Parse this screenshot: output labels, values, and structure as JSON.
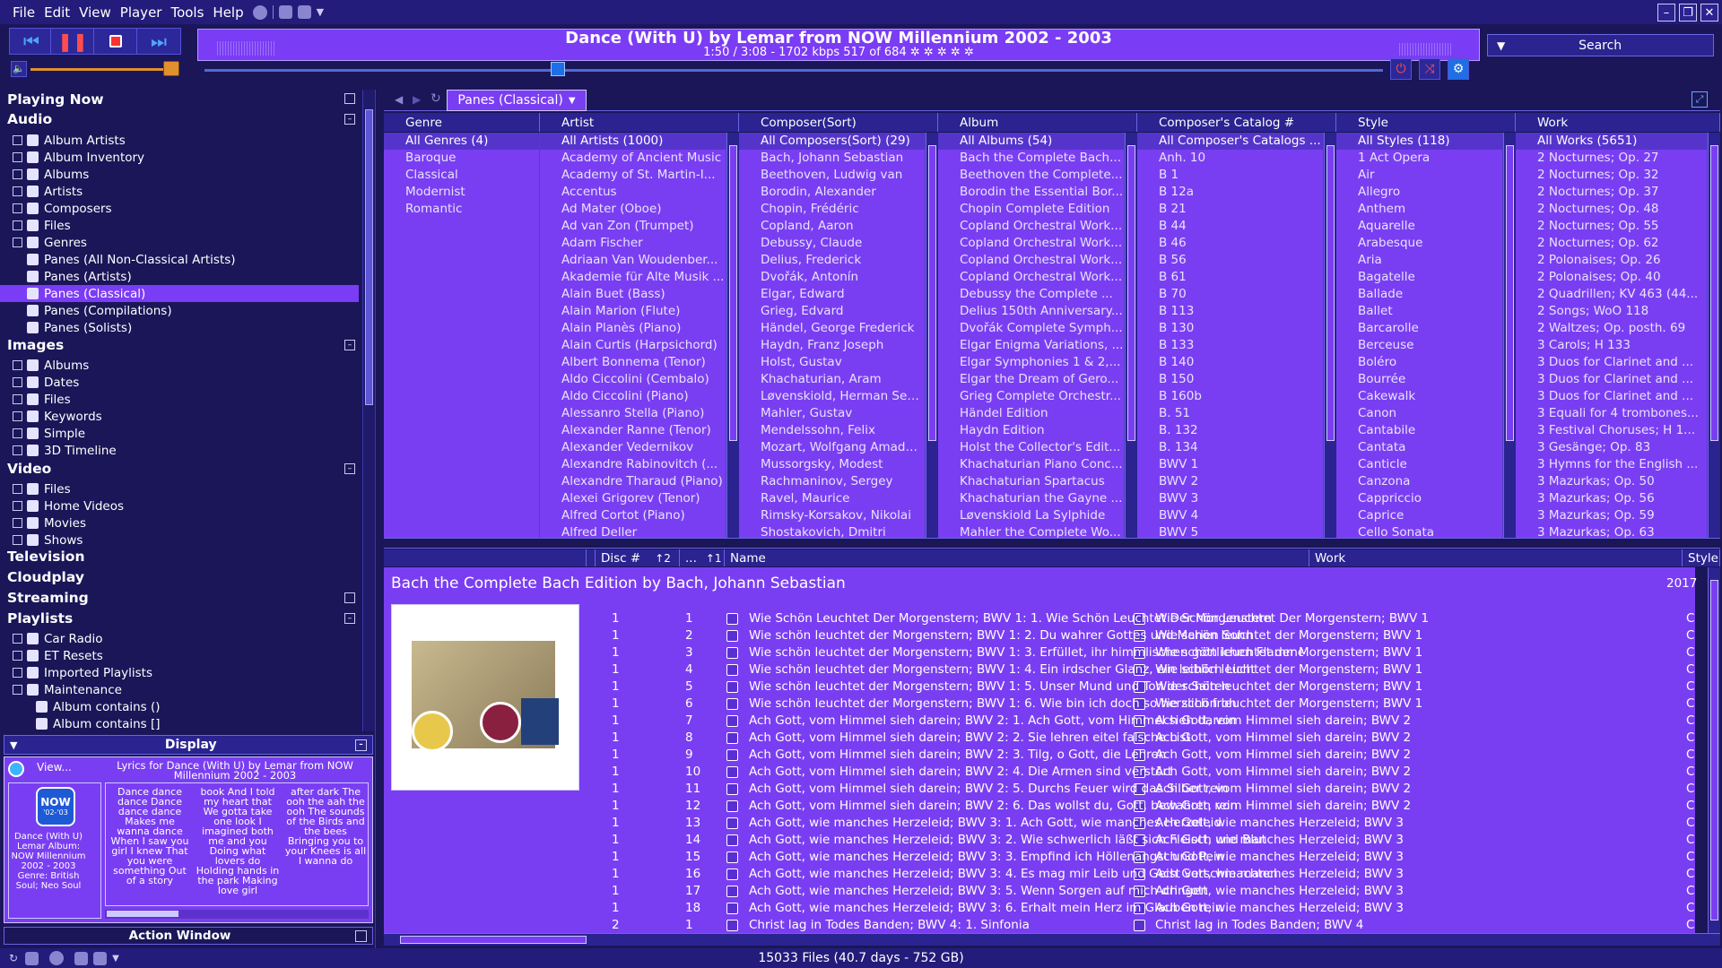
{
  "menu": [
    "File",
    "Edit",
    "View",
    "Player",
    "Tools",
    "Help"
  ],
  "now_playing": {
    "title": "Dance (With U) by Lemar from NOW Millennium 2002 - 2003",
    "info": "1:50 / 3:08 - 1702 kbps   517 of 684  ✲ ✲ ✲ ✲ ✲",
    "progress": 0.3
  },
  "volume": 0.98,
  "search": {
    "label": "Search"
  },
  "left": {
    "playing_now": "Playing Now",
    "audio_header": "Audio",
    "audio_items": [
      "Album Artists",
      "Album Inventory",
      "Albums",
      "Artists",
      "Composers",
      "Files",
      "Genres"
    ],
    "genre_children": [
      "Panes (All Non-Classical Artists)",
      "Panes (Artists)",
      "Panes (Classical)",
      "Panes (Compilations)",
      "Panes (Solists)"
    ],
    "images_header": "Images",
    "images_items": [
      "Albums",
      "Dates",
      "Files",
      "Keywords",
      "Simple",
      "3D Timeline"
    ],
    "video_header": "Video",
    "video_items": [
      "Files",
      "Home Videos",
      "Movies",
      "Shows"
    ],
    "television": "Television",
    "cloudplay": "Cloudplay",
    "streaming": "Streaming",
    "playlists_header": "Playlists",
    "playlists_items": [
      "Car Radio",
      "ET Resets",
      "Imported Playlists",
      "Maintenance"
    ],
    "maintenance_children": [
      "Album contains ()",
      "Album contains []"
    ]
  },
  "display_panel": {
    "header": "Display",
    "view_label": "View...",
    "lyrics_title": "Lyrics for Dance (With U) by Lemar from NOW Millennium 2002 - 2003",
    "album_badge": "NOW",
    "album_badge_sub": "'02-'03",
    "info_text": "Dance (With U) Lemar Album: NOW Millennium 2002 - 2003 Genre: British Soul; Neo Soul",
    "lyrics_col1": "Dance dance dance Dance dance dance Makes me wanna dance  When I saw you girl I knew That you were something Out of a story",
    "lyrics_col2": "book And I told my heart that We gotta take one look I imagined both me and you Doing what lovers do Holding hands in the park Making love girl",
    "lyrics_col3": "after dark  The ooh the aah the ooh The sounds of the Birds and the bees Bringing you to your Knees is all I wanna do",
    "action_window": "Action Window"
  },
  "pane_view": {
    "tab_label": "Panes (Classical)",
    "columns": [
      {
        "header": "Genre",
        "items": [
          "All Genres (4)",
          "Baroque",
          "Classical",
          "Modernist",
          "Romantic"
        ]
      },
      {
        "header": "Artist",
        "items": [
          "All Artists (1000)",
          "Academy of Ancient Music",
          "Academy of St. Martin-I...",
          "Accentus",
          "Ad Mater (Oboe)",
          "Ad van Zon (Trumpet)",
          "Adam Fischer",
          "Adriaan Van Woudenber...",
          "Akademie für Alte Musik ...",
          "Alain Buet (Bass)",
          "Alain Marion (Flute)",
          "Alain Planès (Piano)",
          "Alain Curtis (Harpsichord)",
          "Albert Bonnema (Tenor)",
          "Aldo Ciccolini (Cembalo)",
          "Aldo Ciccolini (Piano)",
          "Alessanro Stella (Piano)",
          "Alexander Ranne (Tenor)",
          "Alexander Vedernikov",
          "Alexandre Rabinovitch (...",
          "Alexandre Tharaud (Piano)",
          "Alexei Grigorev (Tenor)",
          "Alfred Cortot (Piano)",
          "Alfred Deller"
        ]
      },
      {
        "header": "Composer(Sort)",
        "items": [
          "All Composers(Sort) (29)",
          "Bach, Johann Sebastian",
          "Beethoven, Ludwig van",
          "Borodin, Alexander",
          "Chopin, Frédéric",
          "Copland, Aaron",
          "Debussy, Claude",
          "Delius, Frederick",
          "Dvořák, Antonín",
          "Elgar, Edward",
          "Grieg, Edvard",
          "Händel, George Frederick",
          "Haydn, Franz Joseph",
          "Holst, Gustav",
          "Khachaturian, Aram",
          "Løvenskiold, Herman Sev...",
          "Mahler, Gustav",
          "Mendelssohn, Felix",
          "Mozart, Wolfgang Amadeus",
          "Mussorgsky, Modest",
          "Rachmaninov, Sergey",
          "Ravel, Maurice",
          "Rimsky-Korsakov, Nikolai",
          "Shostakovich, Dmitri"
        ]
      },
      {
        "header": "Album",
        "items": [
          "All Albums (54)",
          "Bach the Complete Bach...",
          "Beethoven the Complete...",
          "Borodin the Essential Bor...",
          "Chopin Complete Edition",
          "Copland Orchestral Work...",
          "Copland Orchestral Work...",
          "Copland Orchestral Work...",
          "Copland Orchestral Work...",
          "Debussy the Complete ...",
          "Delius 150th Anniversary...",
          "Dvořák Complete Symph...",
          "Elgar Enigma Variations, ...",
          "Elgar Symphonies 1 & 2,...",
          "Elgar the Dream of Gero...",
          "Grieg Complete Orchestr...",
          "Händel Edition",
          "Haydn Edition",
          "Holst the Collector's Edit...",
          "Khachaturian Piano Conc...",
          "Khachaturian Spartacus",
          "Khachaturian the Gayne ...",
          "Løvenskiold La Sylphide",
          "Mahler the Complete Wo..."
        ]
      },
      {
        "header": "Composer's Catalog #",
        "items": [
          "All Composer's Catalogs ...",
          "Anh. 10",
          "B 1",
          "B 12a",
          "B 21",
          "B 44",
          "B 46",
          "B 56",
          "B 61",
          "B 70",
          "B 113",
          "B 130",
          "B 133",
          "B 140",
          "B 150",
          "B 160b",
          "B. 51",
          "B. 132",
          "B. 134",
          "BWV 1",
          "BWV 2",
          "BWV 3",
          "BWV 4",
          "BWV 5"
        ]
      },
      {
        "header": "Style",
        "items": [
          "All Styles (118)",
          "1 Act Opera",
          "Air",
          "Allegro",
          "Anthem",
          "Aquarelle",
          "Arabesque",
          "Aria",
          "Bagatelle",
          "Ballade",
          "Ballet",
          "Barcarolle",
          "Berceuse",
          "Boléro",
          "Bourrée",
          "Cakewalk",
          "Canon",
          "Cantabile",
          "Cantata",
          "Canticle",
          "Canzona",
          "Cappriccio",
          "Caprice",
          "Cello Sonata"
        ]
      },
      {
        "header": "Work",
        "items": [
          "All Works (5651)",
          "2 Nocturnes; Op. 27",
          "2 Nocturnes; Op. 32",
          "2 Nocturnes; Op. 37",
          "2 Nocturnes; Op. 48",
          "2 Nocturnes; Op. 55",
          "2 Nocturnes; Op. 62",
          "2 Polonaises; Op. 26",
          "2 Polonaises; Op. 40",
          "2 Quadrillen; KV 463 (44...",
          "2 Songs; WoO 118",
          "2 Waltzes; Op. posth. 69",
          "3 Carols; H 133",
          "3 Duos for Clarinet and ...",
          "3 Duos for Clarinet and ...",
          "3 Duos for Clarinet and ...",
          "3 Equali for 4 trombones...",
          "3 Festival Choruses; H 1...",
          "3 Gesänge; Op. 83",
          "3 Hymns for the English ...",
          "3 Mazurkas; Op. 50",
          "3 Mazurkas; Op. 56",
          "3 Mazurkas; Op. 59",
          "3 Mazurkas; Op. 63"
        ]
      }
    ]
  },
  "file_list": {
    "headers": {
      "disc": "Disc #",
      "sort1": "↑2",
      "dots": "...",
      "sort2": "↑1",
      "name": "Name",
      "work": "Work",
      "style": "Style"
    },
    "album_title": "Bach the Complete Bach Edition by Bach, Johann Sebastian",
    "album_year": "2017",
    "rows": [
      {
        "disc": "1",
        "track": "1",
        "name": "Wie Schön Leuchtet Der Morgenstern; BWV 1: 1. Wie Schön Leuchtet Der Morgenstern",
        "work": "Wie Schön Leuchtet Der Morgenstern; BWV 1",
        "style": "Ch"
      },
      {
        "disc": "1",
        "track": "2",
        "name": "Wie schön leuchtet der Morgenstern; BWV 1: 2. Du wahrer Gottes und Marien Sohn",
        "work": "Wie schön leuchtet der Morgenstern; BWV 1",
        "style": "Ch"
      },
      {
        "disc": "1",
        "track": "3",
        "name": "Wie schön leuchtet der Morgenstern; BWV 1: 3. Erfüllet, ihr himmlischen göttlichen Flammen",
        "work": "Wie schön leuchtet der Morgenstern; BWV 1",
        "style": "Ch"
      },
      {
        "disc": "1",
        "track": "4",
        "name": "Wie schön leuchtet der Morgenstern; BWV 1: 4. Ein irdscher Glanz, ein leiblich Licht",
        "work": "Wie schön leuchtet der Morgenstern; BWV 1",
        "style": "Ch"
      },
      {
        "disc": "1",
        "track": "5",
        "name": "Wie schön leuchtet der Morgenstern; BWV 1: 5. Unser Mund und Ton der Saiten",
        "work": "Wie schön leuchtet der Morgenstern; BWV 1",
        "style": "Ch"
      },
      {
        "disc": "1",
        "track": "6",
        "name": "Wie schön leuchtet der Morgenstern; BWV 1: 6. Wie bin ich doch so herzlich froh",
        "work": "Wie schön leuchtet der Morgenstern; BWV 1",
        "style": "Ch"
      },
      {
        "disc": "1",
        "track": "7",
        "name": "Ach Gott, vom Himmel sieh darein; BWV 2: 1. Ach Gott, vom Himmel sieh darein",
        "work": "Ach Gott, vom Himmel sieh darein; BWV 2",
        "style": "Ch"
      },
      {
        "disc": "1",
        "track": "8",
        "name": "Ach Gott, vom Himmel sieh darein; BWV 2: 2. Sie lehren eitel falsche List",
        "work": "Ach Gott, vom Himmel sieh darein; BWV 2",
        "style": "Ch"
      },
      {
        "disc": "1",
        "track": "9",
        "name": "Ach Gott, vom Himmel sieh darein; BWV 2: 3. Tilg, o Gott, die Lehren",
        "work": "Ach Gott, vom Himmel sieh darein; BWV 2",
        "style": "Ch"
      },
      {
        "disc": "1",
        "track": "10",
        "name": "Ach Gott, vom Himmel sieh darein; BWV 2: 4. Die Armen sind verstört",
        "work": "Ach Gott, vom Himmel sieh darein; BWV 2",
        "style": "Ch"
      },
      {
        "disc": "1",
        "track": "11",
        "name": "Ach Gott, vom Himmel sieh darein; BWV 2: 5. Durchs Feuer wird das Silber rein",
        "work": "Ach Gott, vom Himmel sieh darein; BWV 2",
        "style": "Ch"
      },
      {
        "disc": "1",
        "track": "12",
        "name": "Ach Gott, vom Himmel sieh darein; BWV 2: 6. Das wollst du, Gott, bewahren rein",
        "work": "Ach Gott, vom Himmel sieh darein; BWV 2",
        "style": "Ch"
      },
      {
        "disc": "1",
        "track": "13",
        "name": "Ach Gott, wie manches Herzeleid; BWV 3: 1. Ach Gott, wie manches Herzeleid",
        "work": "Ach Gott, wie manches Herzeleid; BWV 3",
        "style": "Ch"
      },
      {
        "disc": "1",
        "track": "14",
        "name": "Ach Gott, wie manches Herzeleid; BWV 3: 2. Wie schwerlich läßt sich Fleisch und Blut",
        "work": "Ach Gott, wie manches Herzeleid; BWV 3",
        "style": "Ch"
      },
      {
        "disc": "1",
        "track": "15",
        "name": "Ach Gott, wie manches Herzeleid; BWV 3: 3. Empfind ich Höllenangst und Pein",
        "work": "Ach Gott, wie manches Herzeleid; BWV 3",
        "style": "Ch"
      },
      {
        "disc": "1",
        "track": "16",
        "name": "Ach Gott, wie manches Herzeleid; BWV 3: 4. Es mag mir Leib und Geist verschmachten",
        "work": "Ach Gott, wie manches Herzeleid; BWV 3",
        "style": "Ch"
      },
      {
        "disc": "1",
        "track": "17",
        "name": "Ach Gott, wie manches Herzeleid; BWV 3: 5. Wenn Sorgen auf mich dringen",
        "work": "Ach Gott, wie manches Herzeleid; BWV 3",
        "style": "Ch"
      },
      {
        "disc": "1",
        "track": "18",
        "name": "Ach Gott, wie manches Herzeleid; BWV 3: 6. Erhalt mein Herz im Glauben rein",
        "work": "Ach Gott, wie manches Herzeleid; BWV 3",
        "style": "Ch"
      },
      {
        "disc": "2",
        "track": "1",
        "name": "Christ lag in Todes Banden; BWV 4: 1. Sinfonia",
        "work": "Christ lag in Todes Banden; BWV 4",
        "style": "Ch"
      }
    ]
  },
  "status": "15033 Files (40.7 days - 752 GB)",
  "colors": {
    "accent": "#7b3cf5",
    "panel": "#1a1658",
    "header": "#2a2390",
    "selected": "#7b3cf5"
  }
}
